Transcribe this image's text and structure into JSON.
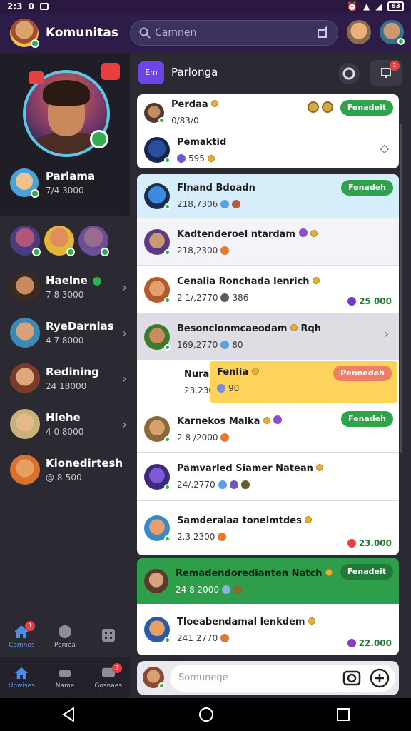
{
  "status_bar": {
    "time": "2:3",
    "extra": "0",
    "battery": "63"
  },
  "top_bar": {
    "title": "Komunitas",
    "search_placeholder": "Camnen"
  },
  "sidebar": {
    "profile": {
      "name": "Parlama",
      "sub": "7/4 3000"
    },
    "items": [
      {
        "name": "Haelne",
        "sub": "7 8 3000",
        "online": true
      },
      {
        "name": "RyeDarnlas",
        "sub": "4 7 8000"
      },
      {
        "name": "Redining",
        "sub": "24 18000"
      },
      {
        "name": "Hlehe",
        "sub": "4 0 8000"
      },
      {
        "name": "Kionedirtesh",
        "sub": "@ 8-500"
      }
    ],
    "dock": [
      {
        "label": "Cemnes",
        "badge": "1"
      },
      {
        "label": "Peniéa"
      }
    ],
    "bottom_tabs": [
      {
        "label": "Uowises"
      },
      {
        "label": "Name"
      },
      {
        "label": "Gosnaes",
        "badge": "3"
      }
    ]
  },
  "channel": {
    "chip": "Em",
    "title": "Parlonga",
    "badge": "1"
  },
  "cards": [
    {
      "rows": [
        {
          "name": "Perdaa",
          "sub": "0/83/0",
          "pill": "Fenadeit"
        },
        {
          "name": "Pemaktid",
          "sub": "595"
        }
      ]
    },
    {
      "rows": [
        {
          "name": "Flnand Bdoadn",
          "sub": "218,7306",
          "pill": "Fenadeh"
        },
        {
          "name": "Kadtenderoel ntardam",
          "sub": "218,2300"
        },
        {
          "name": "Cenalia Ronchada lenrich",
          "sub": "2 1/,2770",
          "sub_extra": "386",
          "corner": "25 000"
        },
        {
          "name": "Besoncionmcaeodam",
          "name_extra": "Rqh",
          "sub": "169,2770",
          "sub_extra": "80"
        },
        {
          "name": "Nuragh",
          "sub": "23.2300",
          "highlight_name": "Fenlia",
          "highlight_sub": "90",
          "pill": "Pennedeh"
        },
        {
          "name": "Karnekos Malka",
          "sub": "2 8 /2000",
          "pill": "Fenadeh"
        },
        {
          "name": "Pamvarled Siamer Natean",
          "sub": "24/.2770"
        },
        {
          "name": "Samderalaa toneimtdes",
          "sub": "2.3 2300",
          "corner": "23.000"
        }
      ]
    },
    {
      "rows": [
        {
          "name": "Remadendoredianten Natch",
          "sub": "24 8 2000",
          "pill": "Fenadeit"
        },
        {
          "name": "Tloeabendamal lenkdem",
          "sub": "241 2770",
          "corner": "22.000"
        }
      ]
    }
  ],
  "composer": {
    "placeholder": "Somunege"
  },
  "colors": {
    "accent": "#2fa34b",
    "header": "#2d1c48",
    "chip": "#6b45e6",
    "salmon": "#f07e66",
    "highlight": "#fdd35a"
  }
}
